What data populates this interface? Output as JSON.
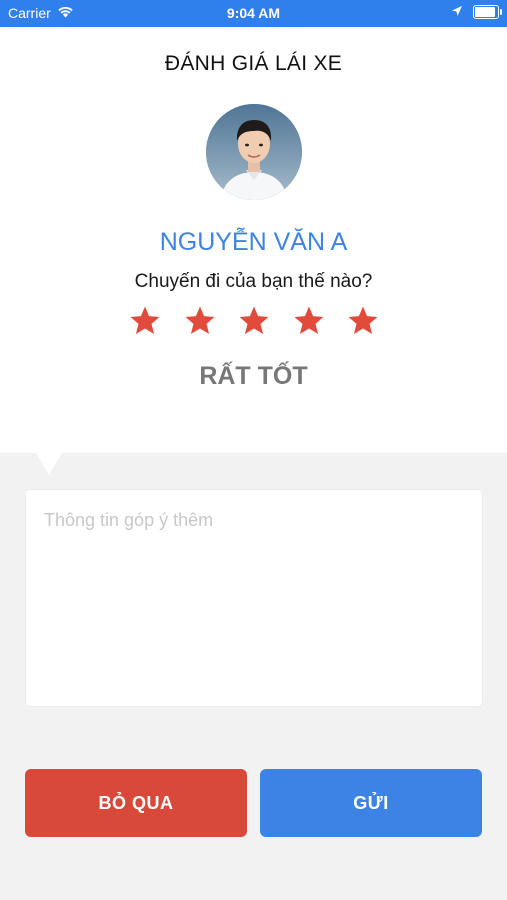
{
  "status_bar": {
    "carrier": "Carrier",
    "time": "9:04 AM",
    "icons": [
      "wifi-icon",
      "location-arrow-icon",
      "battery-icon"
    ]
  },
  "header": {
    "title": "ĐÁNH GIÁ LÁI XE"
  },
  "driver": {
    "name": "NGUYỄN VĂN A",
    "avatar": "driver-photo"
  },
  "rating": {
    "question": "Chuyến đi của bạn thế nào?",
    "stars_selected": 5,
    "stars_total": 5,
    "label": "RẤT TỐT"
  },
  "feedback": {
    "placeholder": "Thông tin góp ý thêm",
    "value": ""
  },
  "actions": {
    "skip_label": "BỎ QUA",
    "send_label": "GỬI"
  },
  "colors": {
    "status_bar": "#2f80ed",
    "accent_blue": "#3d83e5",
    "star_red": "#e04b3b",
    "skip_red": "#d9493a",
    "panel_gray": "#f2f2f2"
  }
}
